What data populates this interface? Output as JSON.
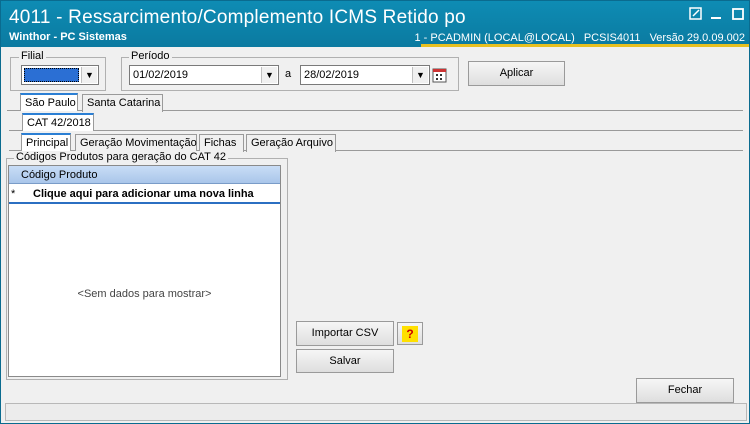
{
  "window": {
    "title": "4011 - Ressarcimento/Complemento ICMS Retido po",
    "subtitle": "Winthor - PC Sistemas",
    "user": "1 - PCADMIN (LOCAL@LOCAL)",
    "program": "PCSIS4011",
    "version": "Versão  29.0.09.002"
  },
  "filial": {
    "legend": "Filial",
    "value": ""
  },
  "periodo": {
    "legend": "Período",
    "start": "01/02/2019",
    "separator": "a",
    "end": "28/02/2019"
  },
  "buttons": {
    "aplicar": "Aplicar",
    "importar": "Importar CSV",
    "salvar": "Salvar",
    "fechar": "Fechar",
    "help": "?"
  },
  "state_tabs": [
    "São Paulo",
    "Santa Catarina"
  ],
  "sub_tab": "CAT 42/2018",
  "main_tabs": [
    "Principal",
    "Geração Movimentação",
    "Fichas",
    "Geração Arquivo"
  ],
  "grid": {
    "legend": "Códigos Produtos para geração do CAT 42",
    "column": "Código Produto",
    "new_row_marker": "*",
    "new_row_text": "Clique aqui para adicionar uma nova linha",
    "empty_text": "<Sem dados para mostrar>"
  },
  "colors": {
    "titlebar": "#0e8cb4",
    "accent": "#2b7fd4",
    "status_line": "#e8c020"
  }
}
